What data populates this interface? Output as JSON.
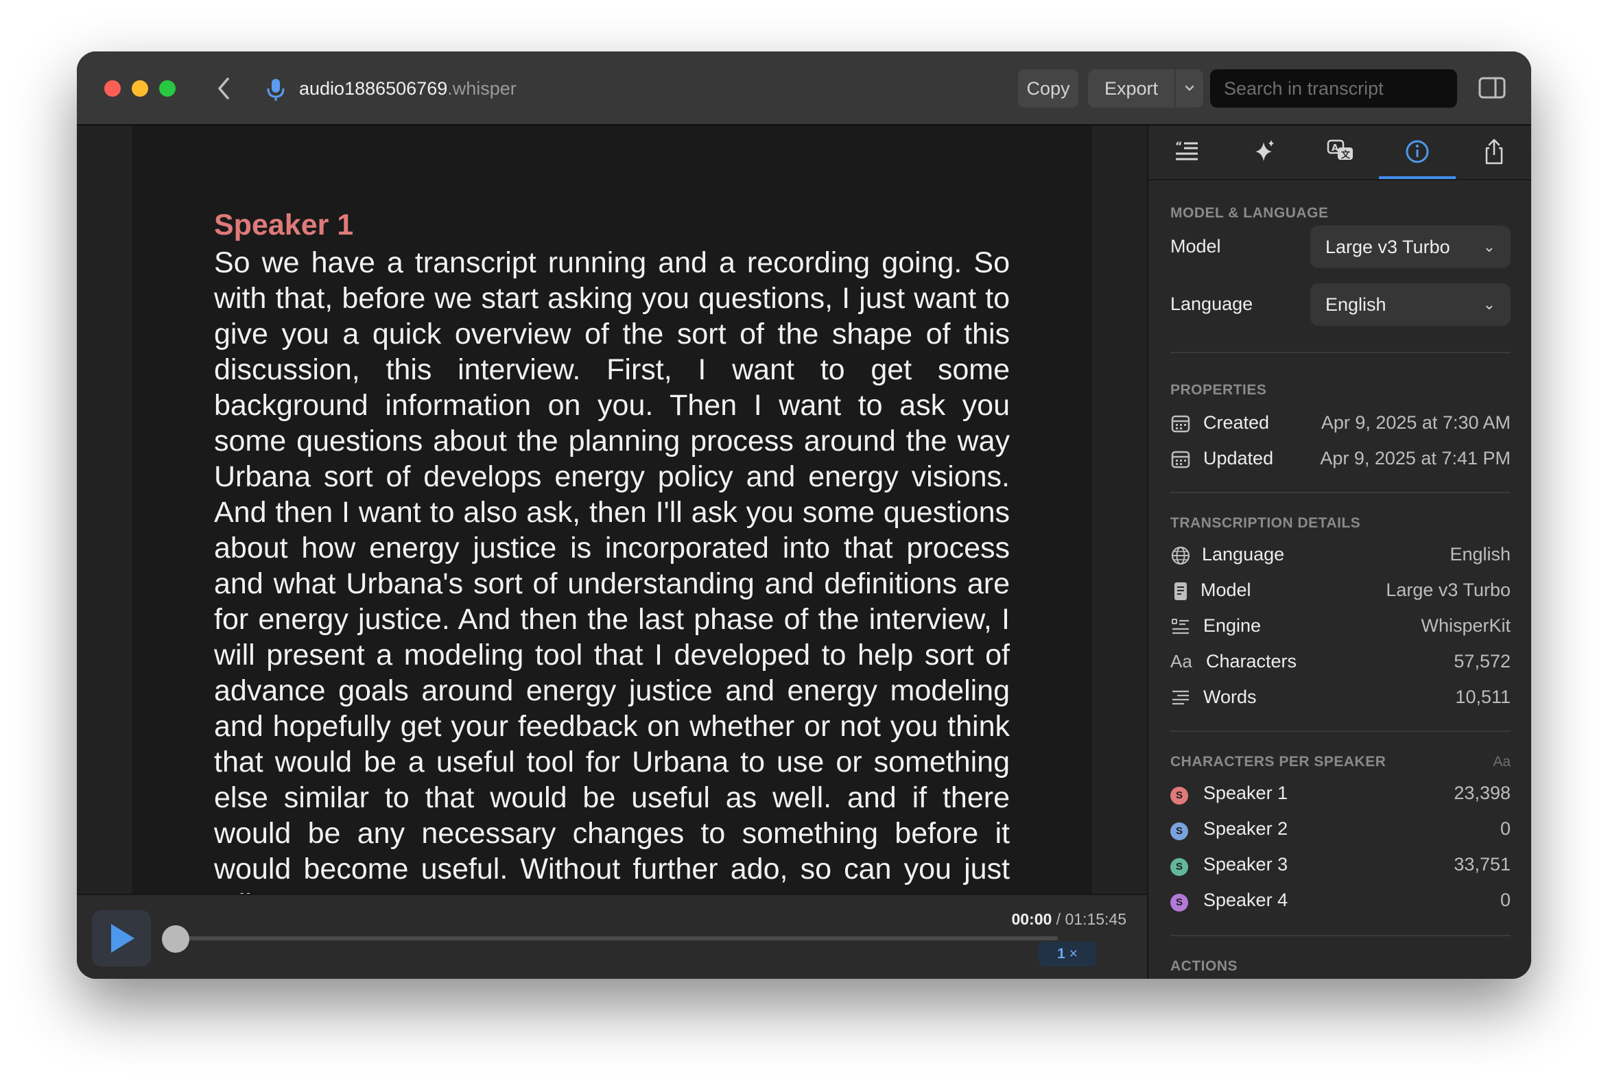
{
  "window": {
    "title_name": "audio1886506769",
    "title_ext": ".whisper"
  },
  "toolbar": {
    "copy_label": "Copy",
    "export_label": "Export",
    "search_placeholder": "Search in transcript"
  },
  "transcript": {
    "speaker": "Speaker 1",
    "text": "So we have a transcript running and a recording going. So with that, before we start asking you questions, I just want to give you a quick overview of the sort of the shape of this discussion, this interview. First, I want to get some background information on you. Then I want to ask you some questions about the planning process around the way Urbana sort of develops energy policy and energy visions. And then I want to also ask, then I'll ask you some questions about how energy justice is incorporated into that process and what Urbana's sort of understanding and definitions are for energy justice. And then the last phase of the interview, I will present a modeling tool that I developed to help sort of advance goals around energy justice and energy modeling and hopefully get your feedback on whether or not you think that would be a useful tool for Urbana to use or something else similar to that would be useful as well. and if there would be any necessary changes to something before it would become useful. Without further ado, so can you just tell me"
  },
  "player": {
    "progress": 0.0,
    "current_time": "00:00",
    "separator": " / ",
    "duration": "01:15:45",
    "speed_value": "1",
    "speed_unit": " ×"
  },
  "sidebar": {
    "tabs": [
      {
        "icon": "transcript-icon",
        "active": false
      },
      {
        "icon": "sparkle-icon",
        "active": false
      },
      {
        "icon": "translate-icon",
        "active": false
      },
      {
        "icon": "info-icon",
        "active": true
      },
      {
        "icon": "share-icon",
        "active": false
      }
    ],
    "model_language": {
      "heading": "MODEL & LANGUAGE",
      "model_label": "Model",
      "model_value": "Large v3 Turbo",
      "language_label": "Language",
      "language_value": "English"
    },
    "properties": {
      "heading": "PROPERTIES",
      "created_label": "Created",
      "created_value": "Apr 9, 2025 at 7:30 AM",
      "updated_label": "Updated",
      "updated_value": "Apr 9, 2025 at 7:41 PM"
    },
    "details": {
      "heading": "TRANSCRIPTION DETAILS",
      "rows": [
        {
          "icon": "globe-icon",
          "label": "Language",
          "value": "English"
        },
        {
          "icon": "document-icon",
          "label": "Model",
          "value": "Large v3 Turbo"
        },
        {
          "icon": "engine-icon",
          "label": "Engine",
          "value": "WhisperKit"
        },
        {
          "icon": "characters-icon",
          "label": "Characters",
          "value": "57,572"
        },
        {
          "icon": "words-icon",
          "label": "Words",
          "value": "10,511"
        }
      ]
    },
    "speakers": {
      "heading": "CHARACTERS PER SPEAKER",
      "aa_label": "Aa",
      "rows": [
        {
          "initial": "S",
          "color": "#e07a7a",
          "label": "Speaker 1",
          "value": "23,398"
        },
        {
          "initial": "S",
          "color": "#7aa2dc",
          "label": "Speaker 2",
          "value": "0"
        },
        {
          "initial": "S",
          "color": "#62b89a",
          "label": "Speaker 3",
          "value": "33,751"
        },
        {
          "initial": "S",
          "color": "#b27ad8",
          "label": "Speaker 4",
          "value": "0"
        }
      ]
    },
    "actions_heading": "ACTIONS"
  }
}
